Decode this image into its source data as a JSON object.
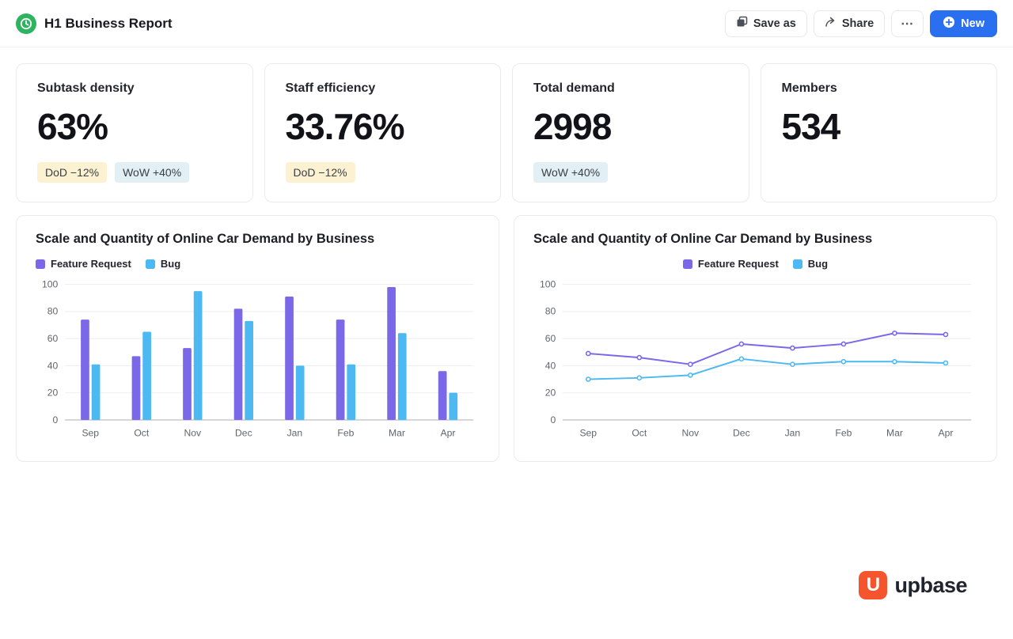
{
  "header": {
    "title": "H1 Business Report",
    "save_as_label": "Save as",
    "share_label": "Share",
    "more_label": "⋯",
    "new_label": "New"
  },
  "kpis": [
    {
      "title": "Subtask density",
      "value": "63%",
      "badges": [
        {
          "label": "DoD −12%",
          "type": "yellow"
        },
        {
          "label": "WoW +40%",
          "type": "blue"
        }
      ]
    },
    {
      "title": "Staff efficiency",
      "value": "33.76%",
      "badges": [
        {
          "label": "DoD −12%",
          "type": "yellow"
        }
      ]
    },
    {
      "title": "Total demand",
      "value": "2998",
      "badges": [
        {
          "label": "WoW +40%",
          "type": "blue"
        }
      ]
    },
    {
      "title": "Members",
      "value": "534",
      "badges": []
    }
  ],
  "chart_data": [
    {
      "type": "bar",
      "title": "Scale and Quantity of Online Car Demand by Business",
      "categories": [
        "Sep",
        "Oct",
        "Nov",
        "Dec",
        "Jan",
        "Feb",
        "Mar",
        "Apr"
      ],
      "series": [
        {
          "name": "Feature Request",
          "color": "#7b68e8",
          "values": [
            74,
            47,
            53,
            82,
            91,
            74,
            98,
            36
          ]
        },
        {
          "name": "Bug",
          "color": "#4cb9f2",
          "values": [
            41,
            65,
            95,
            73,
            40,
            41,
            64,
            20
          ]
        }
      ],
      "ylim": [
        0,
        100
      ],
      "yticks": [
        0,
        20,
        40,
        60,
        80,
        100
      ],
      "legend_position": "left",
      "grid": true,
      "xlabel": "",
      "ylabel": ""
    },
    {
      "type": "line",
      "title": "Scale and Quantity of Online Car Demand by Business",
      "categories": [
        "Sep",
        "Oct",
        "Nov",
        "Dec",
        "Jan",
        "Feb",
        "Mar",
        "Apr"
      ],
      "series": [
        {
          "name": "Feature Request",
          "color": "#7b68e8",
          "values": [
            49,
            46,
            41,
            56,
            53,
            56,
            64,
            63
          ]
        },
        {
          "name": "Bug",
          "color": "#4cb9f2",
          "values": [
            30,
            31,
            33,
            45,
            41,
            43,
            43,
            42
          ]
        }
      ],
      "ylim": [
        0,
        100
      ],
      "yticks": [
        0,
        20,
        40,
        60,
        80,
        100
      ],
      "legend_position": "center",
      "grid": true,
      "xlabel": "",
      "ylabel": ""
    }
  ],
  "footer": {
    "logo_text": "upbase"
  },
  "colors": {
    "accent_blue": "#2a6ff0",
    "brand_green": "#2eb360",
    "brand_orange": "#f4552d",
    "series_purple": "#7b68e8",
    "series_blue": "#4cb9f2",
    "badge_yellow_bg": "#fcf2d2",
    "badge_blue_bg": "#e2eff4"
  }
}
